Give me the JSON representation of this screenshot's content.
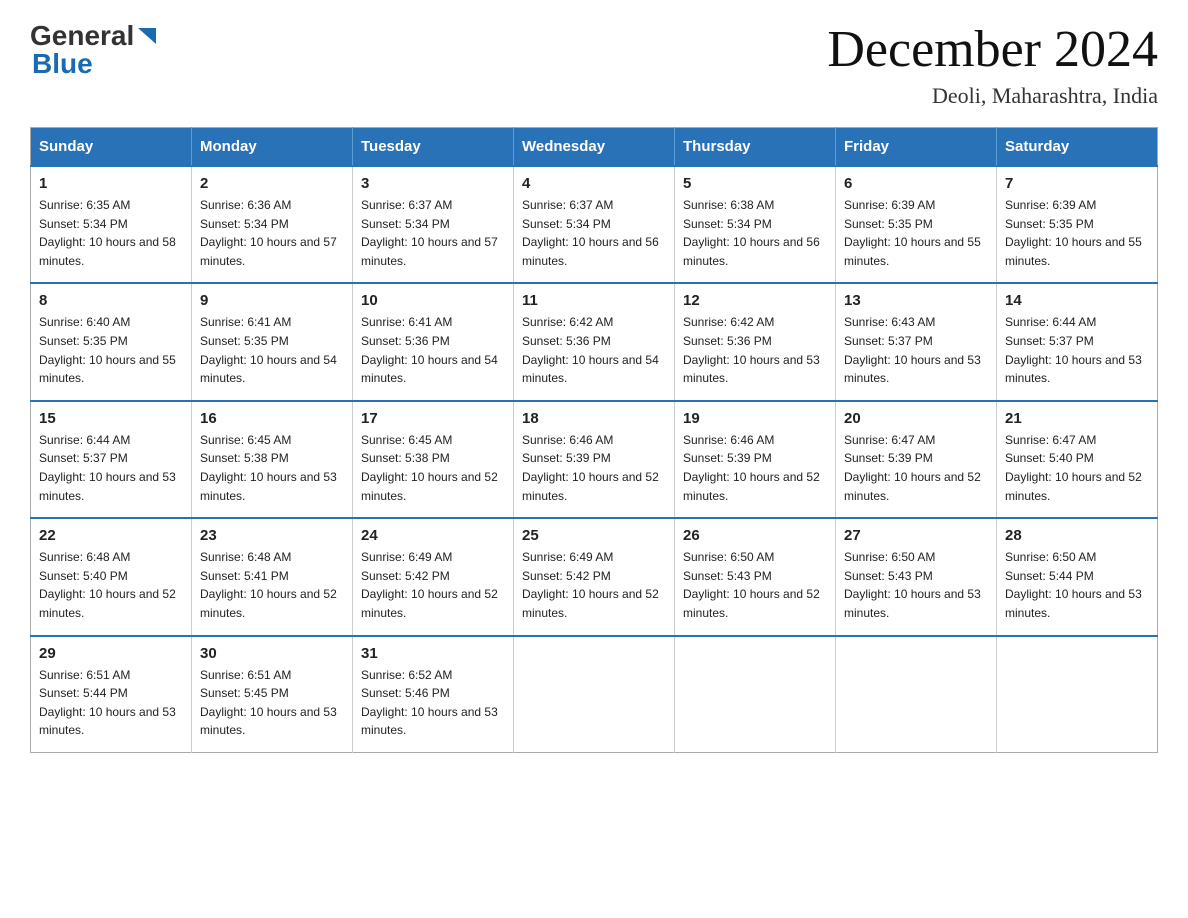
{
  "logo": {
    "general": "General",
    "blue": "Blue"
  },
  "title": {
    "month": "December 2024",
    "location": "Deoli, Maharashtra, India"
  },
  "weekdays": [
    "Sunday",
    "Monday",
    "Tuesday",
    "Wednesday",
    "Thursday",
    "Friday",
    "Saturday"
  ],
  "weeks": [
    [
      {
        "day": "1",
        "sunrise": "6:35 AM",
        "sunset": "5:34 PM",
        "daylight": "10 hours and 58 minutes."
      },
      {
        "day": "2",
        "sunrise": "6:36 AM",
        "sunset": "5:34 PM",
        "daylight": "10 hours and 57 minutes."
      },
      {
        "day": "3",
        "sunrise": "6:37 AM",
        "sunset": "5:34 PM",
        "daylight": "10 hours and 57 minutes."
      },
      {
        "day": "4",
        "sunrise": "6:37 AM",
        "sunset": "5:34 PM",
        "daylight": "10 hours and 56 minutes."
      },
      {
        "day": "5",
        "sunrise": "6:38 AM",
        "sunset": "5:34 PM",
        "daylight": "10 hours and 56 minutes."
      },
      {
        "day": "6",
        "sunrise": "6:39 AM",
        "sunset": "5:35 PM",
        "daylight": "10 hours and 55 minutes."
      },
      {
        "day": "7",
        "sunrise": "6:39 AM",
        "sunset": "5:35 PM",
        "daylight": "10 hours and 55 minutes."
      }
    ],
    [
      {
        "day": "8",
        "sunrise": "6:40 AM",
        "sunset": "5:35 PM",
        "daylight": "10 hours and 55 minutes."
      },
      {
        "day": "9",
        "sunrise": "6:41 AM",
        "sunset": "5:35 PM",
        "daylight": "10 hours and 54 minutes."
      },
      {
        "day": "10",
        "sunrise": "6:41 AM",
        "sunset": "5:36 PM",
        "daylight": "10 hours and 54 minutes."
      },
      {
        "day": "11",
        "sunrise": "6:42 AM",
        "sunset": "5:36 PM",
        "daylight": "10 hours and 54 minutes."
      },
      {
        "day": "12",
        "sunrise": "6:42 AM",
        "sunset": "5:36 PM",
        "daylight": "10 hours and 53 minutes."
      },
      {
        "day": "13",
        "sunrise": "6:43 AM",
        "sunset": "5:37 PM",
        "daylight": "10 hours and 53 minutes."
      },
      {
        "day": "14",
        "sunrise": "6:44 AM",
        "sunset": "5:37 PM",
        "daylight": "10 hours and 53 minutes."
      }
    ],
    [
      {
        "day": "15",
        "sunrise": "6:44 AM",
        "sunset": "5:37 PM",
        "daylight": "10 hours and 53 minutes."
      },
      {
        "day": "16",
        "sunrise": "6:45 AM",
        "sunset": "5:38 PM",
        "daylight": "10 hours and 53 minutes."
      },
      {
        "day": "17",
        "sunrise": "6:45 AM",
        "sunset": "5:38 PM",
        "daylight": "10 hours and 52 minutes."
      },
      {
        "day": "18",
        "sunrise": "6:46 AM",
        "sunset": "5:39 PM",
        "daylight": "10 hours and 52 minutes."
      },
      {
        "day": "19",
        "sunrise": "6:46 AM",
        "sunset": "5:39 PM",
        "daylight": "10 hours and 52 minutes."
      },
      {
        "day": "20",
        "sunrise": "6:47 AM",
        "sunset": "5:39 PM",
        "daylight": "10 hours and 52 minutes."
      },
      {
        "day": "21",
        "sunrise": "6:47 AM",
        "sunset": "5:40 PM",
        "daylight": "10 hours and 52 minutes."
      }
    ],
    [
      {
        "day": "22",
        "sunrise": "6:48 AM",
        "sunset": "5:40 PM",
        "daylight": "10 hours and 52 minutes."
      },
      {
        "day": "23",
        "sunrise": "6:48 AM",
        "sunset": "5:41 PM",
        "daylight": "10 hours and 52 minutes."
      },
      {
        "day": "24",
        "sunrise": "6:49 AM",
        "sunset": "5:42 PM",
        "daylight": "10 hours and 52 minutes."
      },
      {
        "day": "25",
        "sunrise": "6:49 AM",
        "sunset": "5:42 PM",
        "daylight": "10 hours and 52 minutes."
      },
      {
        "day": "26",
        "sunrise": "6:50 AM",
        "sunset": "5:43 PM",
        "daylight": "10 hours and 52 minutes."
      },
      {
        "day": "27",
        "sunrise": "6:50 AM",
        "sunset": "5:43 PM",
        "daylight": "10 hours and 53 minutes."
      },
      {
        "day": "28",
        "sunrise": "6:50 AM",
        "sunset": "5:44 PM",
        "daylight": "10 hours and 53 minutes."
      }
    ],
    [
      {
        "day": "29",
        "sunrise": "6:51 AM",
        "sunset": "5:44 PM",
        "daylight": "10 hours and 53 minutes."
      },
      {
        "day": "30",
        "sunrise": "6:51 AM",
        "sunset": "5:45 PM",
        "daylight": "10 hours and 53 minutes."
      },
      {
        "day": "31",
        "sunrise": "6:52 AM",
        "sunset": "5:46 PM",
        "daylight": "10 hours and 53 minutes."
      },
      null,
      null,
      null,
      null
    ]
  ]
}
